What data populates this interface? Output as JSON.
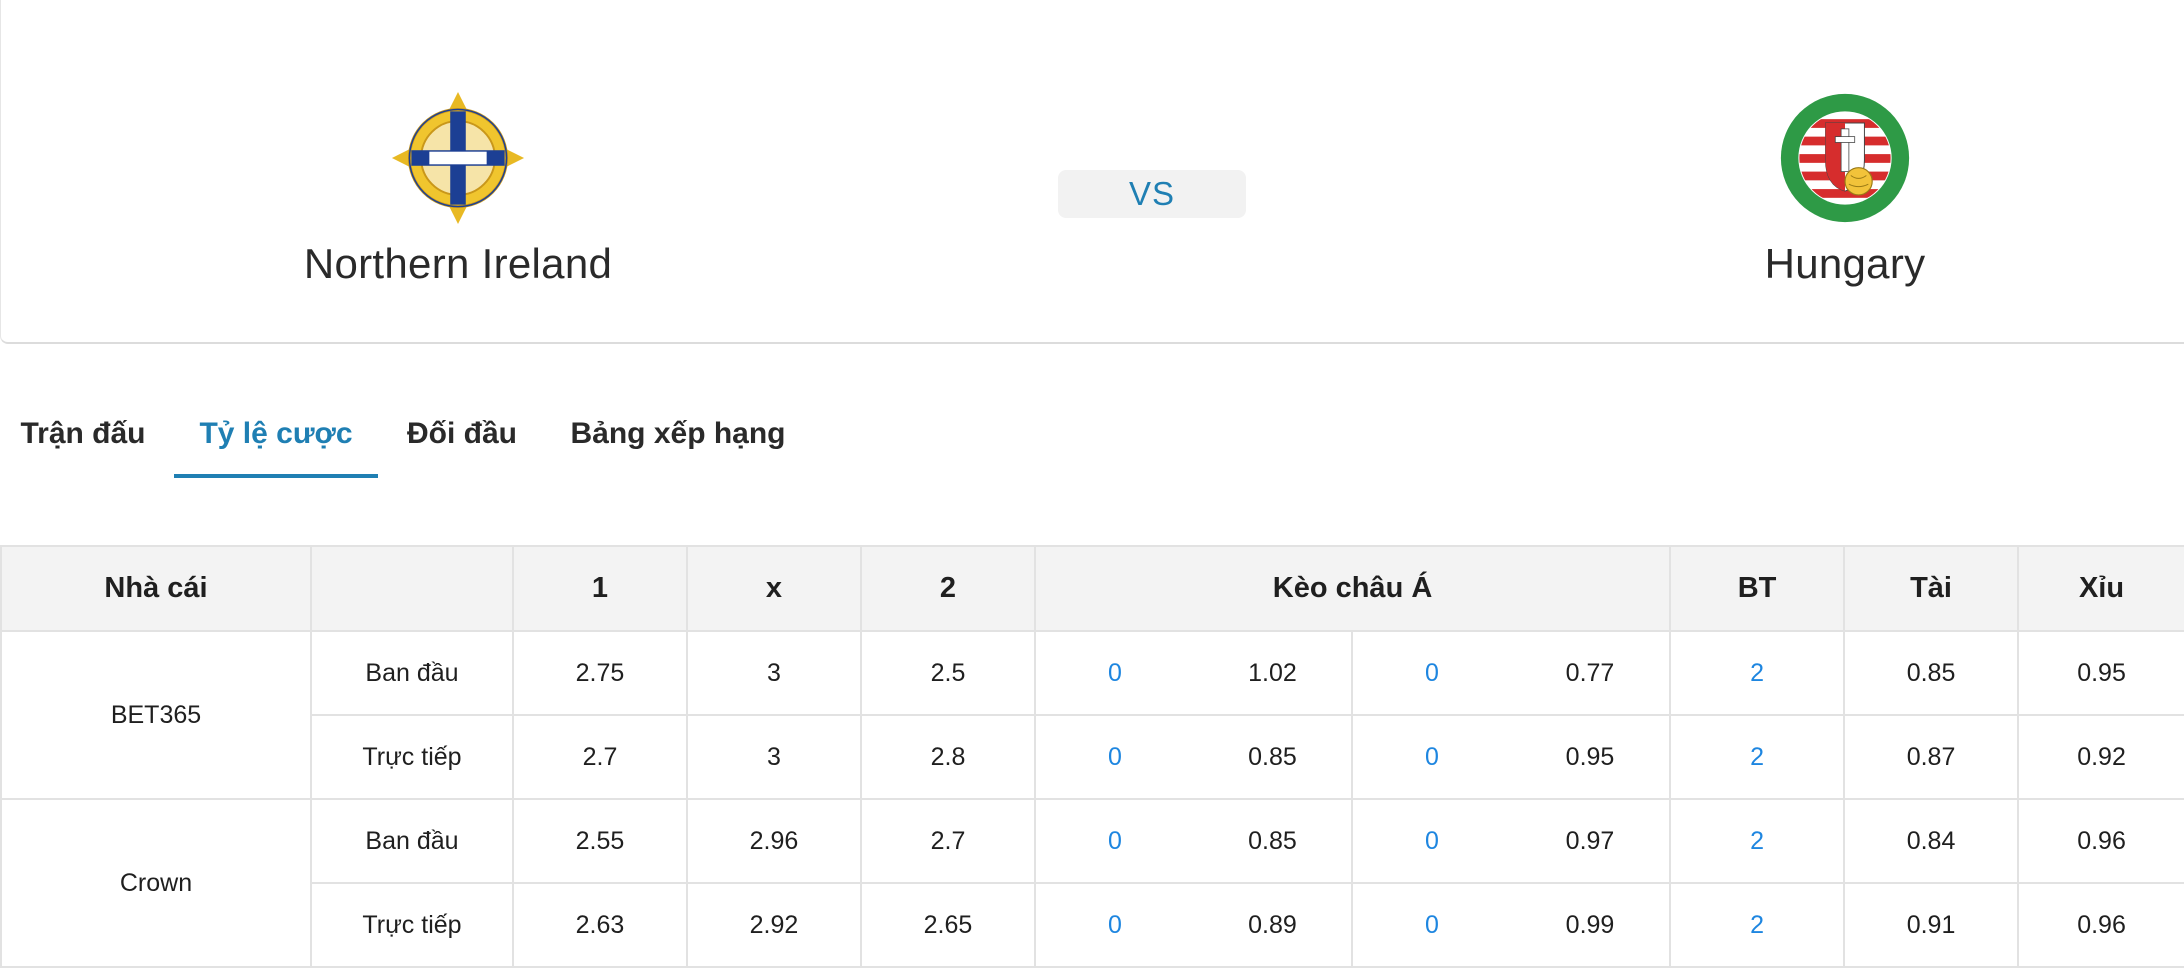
{
  "match": {
    "home": {
      "name": "Northern Ireland",
      "crest_icon": "northern-ireland-fa-crest-icon"
    },
    "away": {
      "name": "Hungary",
      "crest_icon": "hungary-fa-crest-icon"
    },
    "vs_label": "VS"
  },
  "tabs": [
    {
      "label": "Trận đấu",
      "active": false
    },
    {
      "label": "Tỷ lệ cược",
      "active": true
    },
    {
      "label": "Đối đầu",
      "active": false
    },
    {
      "label": "Bảng xếp hạng",
      "active": false
    }
  ],
  "odds_table": {
    "headers": {
      "bookmaker": "Nhà cái",
      "type": "",
      "home": "1",
      "draw": "x",
      "away": "2",
      "asian": "Kèo châu Á",
      "bt": "BT",
      "over": "Tài",
      "under": "Xỉu"
    },
    "bookmakers": [
      {
        "name": "BET365",
        "rows": [
          {
            "type": "Ban đầu",
            "h": "2.75",
            "x": "3",
            "a": "2.5",
            "ah_home_line": "0",
            "ah_home_odds": "1.02",
            "ah_away_line": "0",
            "ah_away_odds": "0.77",
            "bt": "2",
            "over": "0.85",
            "under": "0.95"
          },
          {
            "type": "Trực tiếp",
            "h": "2.7",
            "x": "3",
            "a": "2.8",
            "ah_home_line": "0",
            "ah_home_odds": "0.85",
            "ah_away_line": "0",
            "ah_away_odds": "0.95",
            "bt": "2",
            "over": "0.87",
            "under": "0.92"
          }
        ]
      },
      {
        "name": "Crown",
        "rows": [
          {
            "type": "Ban đầu",
            "h": "2.55",
            "x": "2.96",
            "a": "2.7",
            "ah_home_line": "0",
            "ah_home_odds": "0.85",
            "ah_away_line": "0",
            "ah_away_odds": "0.97",
            "bt": "2",
            "over": "0.84",
            "under": "0.96"
          },
          {
            "type": "Trực tiếp",
            "h": "2.63",
            "x": "2.92",
            "a": "2.65",
            "ah_home_line": "0",
            "ah_home_odds": "0.89",
            "ah_away_line": "0",
            "ah_away_odds": "0.99",
            "bt": "2",
            "over": "0.91",
            "under": "0.96"
          }
        ]
      }
    ]
  },
  "colors": {
    "accent": "#1f7fb3",
    "link_blue": "#1e86e0",
    "header_bg": "#f3f3f3",
    "border": "#e2e2e2"
  }
}
